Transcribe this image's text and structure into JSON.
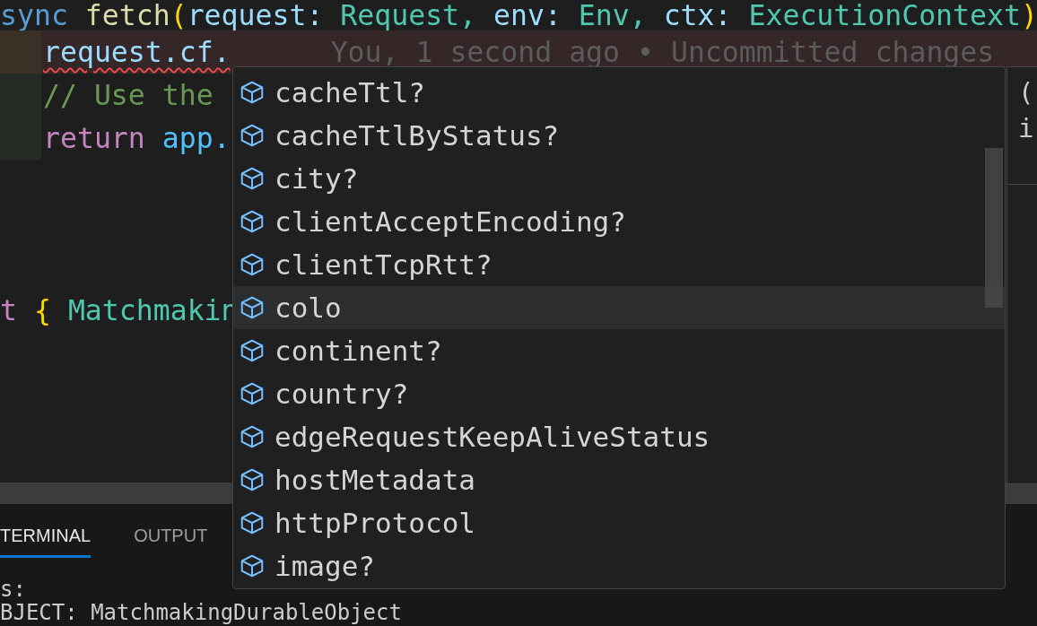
{
  "editor": {
    "lines": [
      {
        "added": false,
        "current": false,
        "indent": false,
        "tokens": [
          {
            "text": "sync ",
            "kind": "keyword"
          },
          {
            "text": "fetch",
            "kind": "function"
          },
          {
            "text": "(",
            "kind": "bracket"
          },
          {
            "text": "request: ",
            "kind": "variable"
          },
          {
            "text": "Request, ",
            "kind": "type"
          },
          {
            "text": "env: ",
            "kind": "variable"
          },
          {
            "text": "Env, ",
            "kind": "type"
          },
          {
            "text": "ctx: ",
            "kind": "variable"
          },
          {
            "text": "ExecutionContext",
            "kind": "type"
          },
          {
            "text": ")",
            "kind": "bracket"
          }
        ]
      },
      {
        "added": true,
        "current": true,
        "indent": true,
        "error": true,
        "blame": "You, 1 second ago • Uncommitted changes",
        "tokens": [
          {
            "text": "request.cf.",
            "kind": "variable"
          }
        ]
      },
      {
        "added": true,
        "current": false,
        "indent": true,
        "tokens": [
          {
            "text": "// Use the",
            "kind": "comment"
          }
        ]
      },
      {
        "added": true,
        "current": false,
        "indent": true,
        "tokens": [
          {
            "text": "return ",
            "kind": "control"
          },
          {
            "text": "app.",
            "kind": "constant"
          }
        ]
      },
      {
        "added": false,
        "current": false,
        "indent": false,
        "tokens": [
          {
            "text": "t ",
            "kind": "control"
          },
          {
            "text": "{ ",
            "kind": "bracket"
          },
          {
            "text": "Matchmakin",
            "kind": "type"
          }
        ]
      }
    ]
  },
  "suggestions": [
    {
      "label": "cacheTtl?",
      "selected": false
    },
    {
      "label": "cacheTtlByStatus?",
      "selected": false
    },
    {
      "label": "city?",
      "selected": false
    },
    {
      "label": "clientAcceptEncoding?",
      "selected": false
    },
    {
      "label": "clientTcpRtt?",
      "selected": false
    },
    {
      "label": "colo",
      "selected": true
    },
    {
      "label": "continent?",
      "selected": false
    },
    {
      "label": "country?",
      "selected": false
    },
    {
      "label": "edgeRequestKeepAliveStatus",
      "selected": false
    },
    {
      "label": "hostMetadata",
      "selected": false
    },
    {
      "label": "httpProtocol",
      "selected": false
    },
    {
      "label": "image?",
      "selected": false
    }
  ],
  "details": {
    "lines": [
      "(",
      "i"
    ]
  },
  "panel": {
    "tabs": [
      {
        "label": "TERMINAL",
        "selected": true
      },
      {
        "label": "OUTPUT",
        "selected": false
      }
    ],
    "terminal_lines": [
      "s:",
      "BJECT: MatchmakingDurableObject"
    ]
  }
}
